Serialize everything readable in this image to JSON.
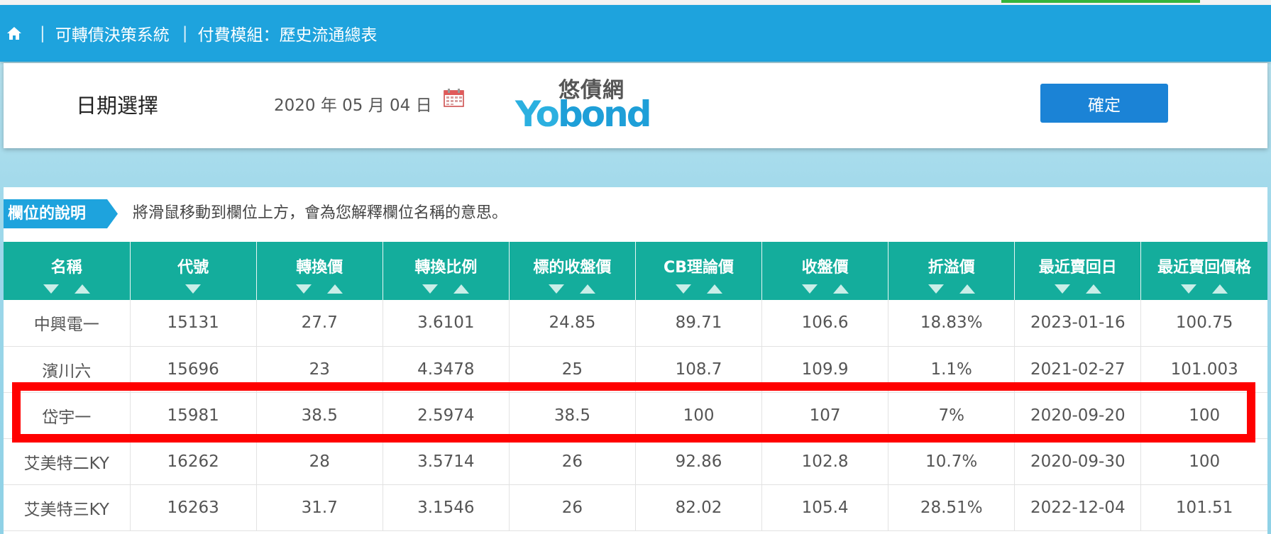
{
  "nav": {
    "breadcrumbs": [
      "可轉債決策系統",
      "付費模組：歷史流通總表"
    ],
    "separator": "|"
  },
  "date_selector": {
    "label": "日期選擇",
    "value": "2020 年 05 月 04 日",
    "confirm_label": "確定"
  },
  "logo": {
    "cn": "悠債網",
    "en_y": "Yo",
    "en_rest": "bond"
  },
  "description": {
    "tag": "欄位的說明",
    "text": "將滑鼠移動到欄位上方，會為您解釋欄位名稱的意思。"
  },
  "table": {
    "columns": [
      {
        "label": "名稱",
        "sort": [
          "down",
          "up"
        ]
      },
      {
        "label": "代號",
        "sort": [
          "down"
        ]
      },
      {
        "label": "轉換價",
        "sort": [
          "down",
          "up"
        ]
      },
      {
        "label": "轉換比例",
        "sort": [
          "down",
          "up"
        ]
      },
      {
        "label": "標的收盤價",
        "sort": [
          "down",
          "up"
        ]
      },
      {
        "label": "CB理論價",
        "sort": [
          "down",
          "up"
        ]
      },
      {
        "label": "收盤價",
        "sort": [
          "down",
          "up"
        ]
      },
      {
        "label": "折溢價",
        "sort": [
          "down",
          "up"
        ]
      },
      {
        "label": "最近賣回日",
        "sort": [
          "down",
          "up"
        ]
      },
      {
        "label": "最近賣回價格",
        "sort": [
          "down",
          "up"
        ]
      }
    ],
    "rows": [
      [
        "中興電一",
        "15131",
        "27.7",
        "3.6101",
        "24.85",
        "89.71",
        "106.6",
        "18.83%",
        "2023-01-16",
        "100.75"
      ],
      [
        "濱川六",
        "15696",
        "23",
        "4.3478",
        "25",
        "108.7",
        "109.9",
        "1.1%",
        "2021-02-27",
        "101.003"
      ],
      [
        "岱宇一",
        "15981",
        "38.5",
        "2.5974",
        "38.5",
        "100",
        "107",
        "7%",
        "2020-09-20",
        "100"
      ],
      [
        "艾美特二KY",
        "16262",
        "28",
        "3.5714",
        "26",
        "92.86",
        "102.8",
        "10.7%",
        "2020-09-30",
        "100"
      ],
      [
        "艾美特三KY",
        "16263",
        "31.7",
        "3.1546",
        "26",
        "82.02",
        "105.4",
        "28.51%",
        "2022-12-04",
        "101.51"
      ]
    ],
    "highlighted_row": 2
  },
  "colors": {
    "navbar": "#1ea3dd",
    "header": "#14ad9c",
    "confirm_button": "#1b83d6",
    "highlight": "#ff0000"
  }
}
